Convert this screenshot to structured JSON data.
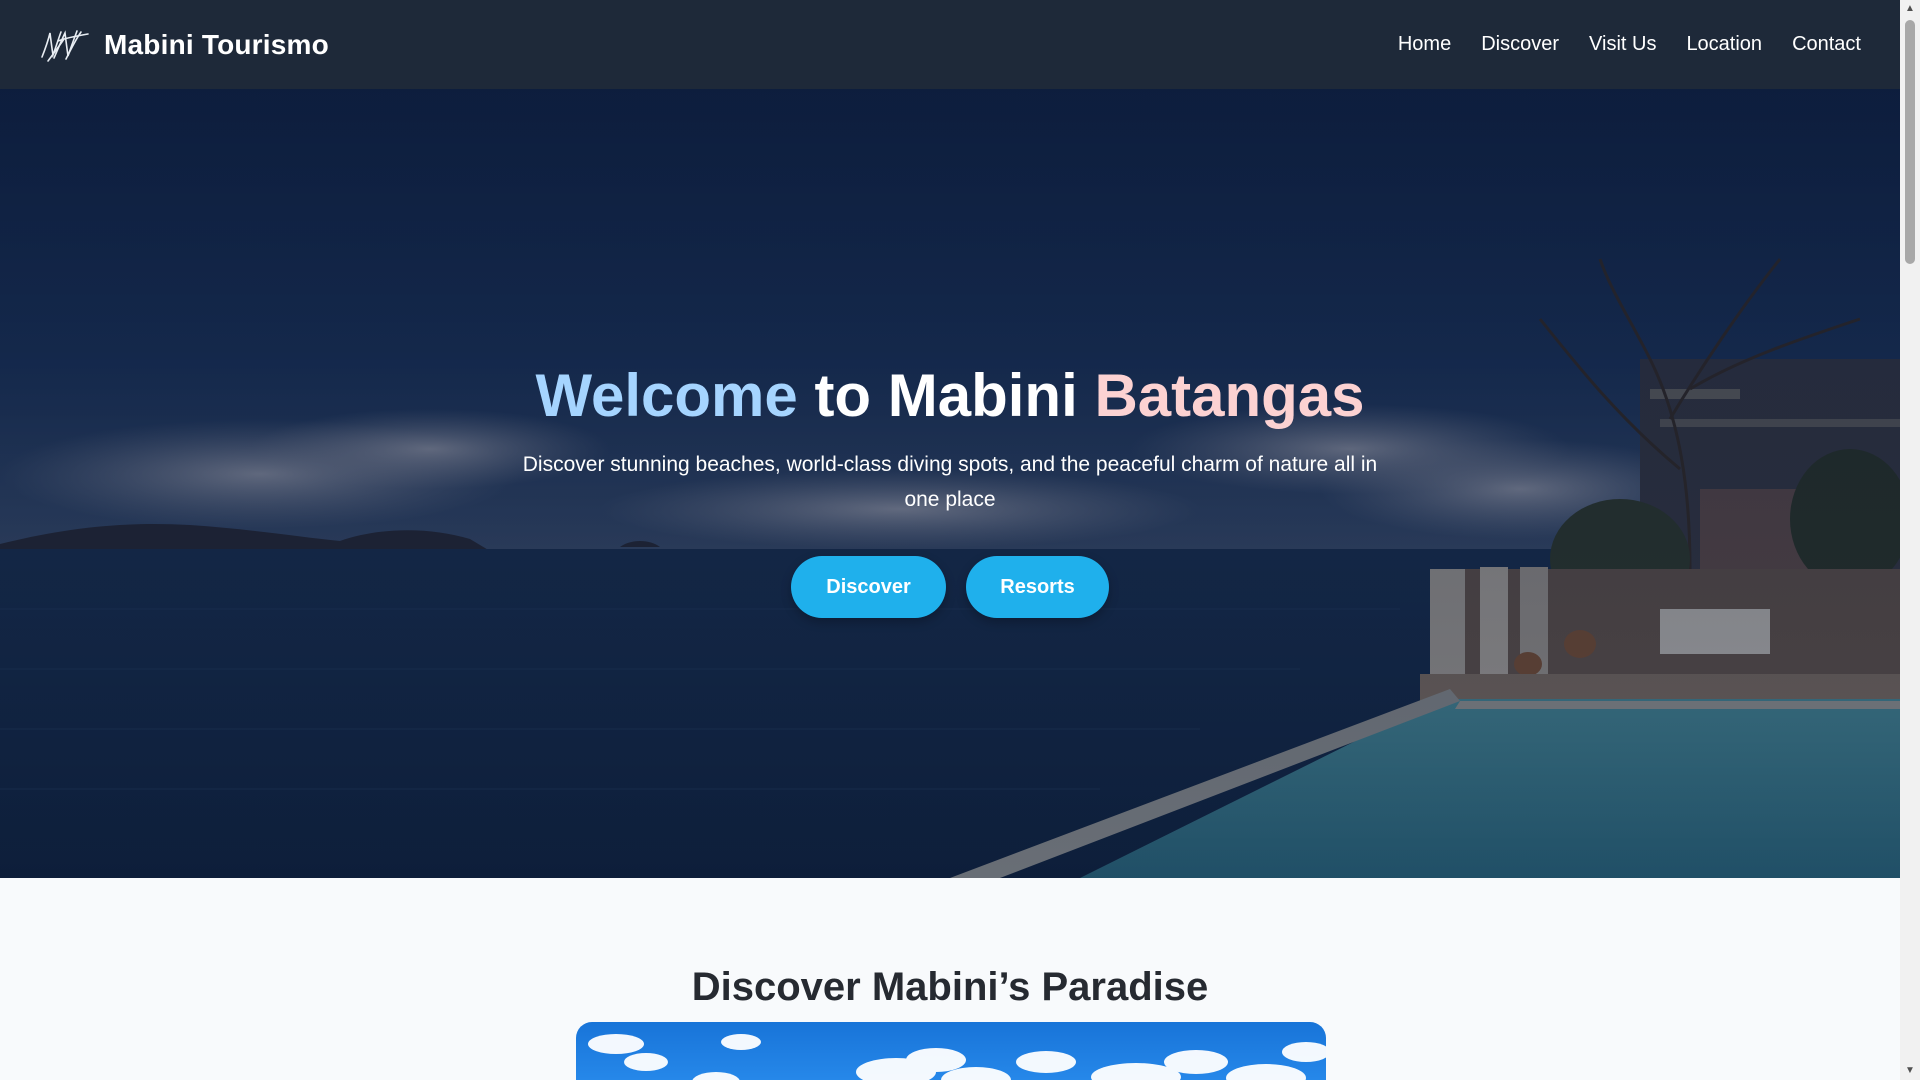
{
  "brand": {
    "name": "Mabini Tourismo",
    "logo_icon": "signature-logo-icon"
  },
  "nav": {
    "items": [
      "Home",
      "Discover",
      "Visit Us",
      "Location",
      "Contact"
    ]
  },
  "hero": {
    "title_parts": {
      "welcome": "Welcome",
      "to": "to",
      "mabini": "Mabini",
      "batangas": "Batangas"
    },
    "subtitle": "Discover stunning beaches, world-class diving spots, and the peaceful charm of nature all in one place",
    "buttons": {
      "discover": "Discover",
      "resorts": "Resorts"
    }
  },
  "discover_section": {
    "title": "Discover Mabini’s Paradise"
  },
  "colors": {
    "navbar_bg": "#1e2939",
    "button_bg": "#1fb0ec",
    "title_accent_blue": "#a5d4ff",
    "title_accent_pink": "#fcd2d2",
    "section_bg": "#f8fafc",
    "section_title": "#262a31"
  },
  "scrollbar": {
    "up_icon": "triangle-up-icon",
    "down_icon": "triangle-down-icon"
  }
}
